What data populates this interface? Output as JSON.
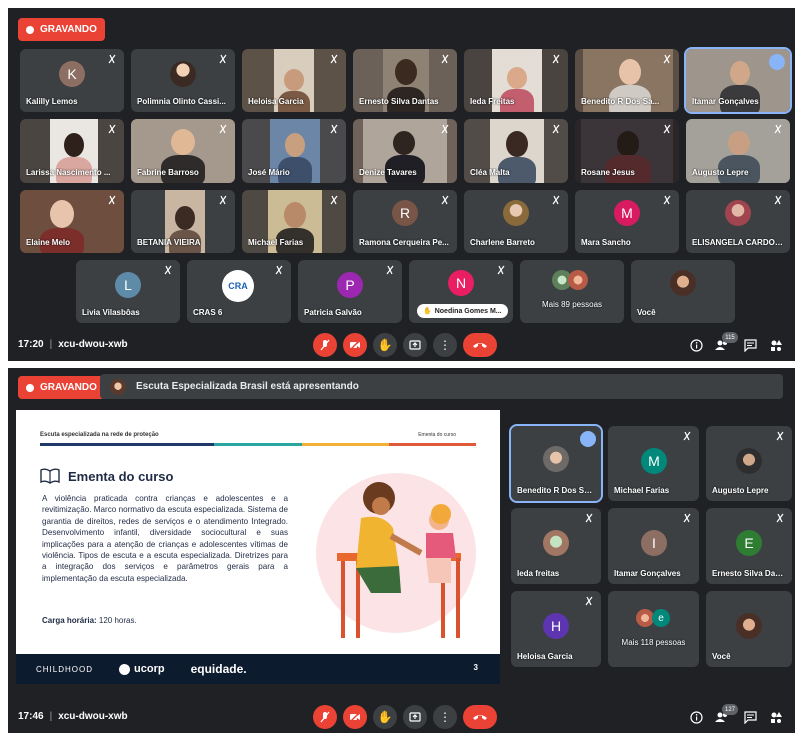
{
  "top": {
    "recording_label": "GRAVANDO",
    "time": "17:20",
    "meeting_code": "xcu-dwou-xwb",
    "people_count": "115",
    "participants": [
      {
        "name": "Kalilly Lemos",
        "initial": "K",
        "color": "#8d6e63"
      },
      {
        "name": "Polimnia Olinto Cassi..."
      },
      {
        "name": "Heloisa Garcia"
      },
      {
        "name": "Ernesto Silva Dantas"
      },
      {
        "name": "Ieda Freitas"
      },
      {
        "name": "Benedito R Dos Sa..."
      },
      {
        "name": "Itamar Gonçalves"
      },
      {
        "name": "Larissa Nascimento ..."
      },
      {
        "name": "Fabrine Barroso"
      },
      {
        "name": "José Mário"
      },
      {
        "name": "Denize Tavares"
      },
      {
        "name": "Cléa Malta"
      },
      {
        "name": "Rosane Jesus"
      },
      {
        "name": "Augusto Lepre"
      },
      {
        "name": "Elaine Melo"
      },
      {
        "name": "BETANIA VIEIRA"
      },
      {
        "name": "Michael Farias"
      },
      {
        "name": "Ramona Cerqueira Pe...",
        "initial": "R",
        "color": "#795548"
      },
      {
        "name": "Charlene Barreto"
      },
      {
        "name": "Mara Sancho",
        "initial": "M",
        "color": "#d81b60"
      },
      {
        "name": "ELISANGELA CARDOSO"
      },
      {
        "name": "Livia Vilasbôas",
        "initial": "L",
        "color": "#5e8ca8"
      },
      {
        "name": "CRAS 6"
      },
      {
        "name": "Patricia Galvão",
        "initial": "P",
        "color": "#9c27b0"
      },
      {
        "name": "Noedina Gomes M...",
        "initial": "N",
        "color": "#e91e63"
      },
      {
        "name": "Mais 89 pessoas"
      },
      {
        "name": "Você"
      }
    ],
    "cras_logo_text": "CRA"
  },
  "bottom": {
    "recording_label": "GRAVANDO",
    "presenter_text": "Escuta Especializada Brasil está apresentando",
    "time": "17:46",
    "meeting_code": "xcu-dwou-xwb",
    "people_count": "127",
    "slide": {
      "header_left": "Escuta especializada na rede de proteção",
      "header_right": "Ementa do curso",
      "title": "Ementa do curso",
      "body": "A violência praticada contra crianças e adolescentes e a revitimização. Marco normativo da escuta especializada. Sistema de garantia de direitos, redes de serviços e o atendimento Integrado. Desenvolvimento infantil, diversidade sociocultural e suas implicações para a atenção de crianças e adolescentes vítimas de violência. Tipos de escuta e a escuta especializada. Diretrizes para a integração dos serviços e parâmetros gerais para a implementação da escuta especializada.",
      "hours_label": "Carga horária:",
      "hours_value": " 120 horas.",
      "footer_logo_1": "CHILDHOOD",
      "footer_logo_2": "ucorp",
      "footer_logo_3": "equidade.",
      "page_number": "3"
    },
    "participants": [
      {
        "name": "Benedito R Dos Sa..."
      },
      {
        "name": "Michael Farias",
        "initial": "M",
        "color": "#00897b"
      },
      {
        "name": "Augusto Lepre"
      },
      {
        "name": "Ieda freitas"
      },
      {
        "name": "Itamar Gonçalves",
        "initial": "I",
        "color": "#8d6e63"
      },
      {
        "name": "Ernesto Silva Dant...",
        "initial": "E",
        "color": "#2e7d32"
      },
      {
        "name": "Heloisa Garcia",
        "initial": "H",
        "color": "#5e35b1"
      },
      {
        "name": "Mais 118 pessoas",
        "mini_initial": "e"
      },
      {
        "name": "Você"
      }
    ]
  }
}
